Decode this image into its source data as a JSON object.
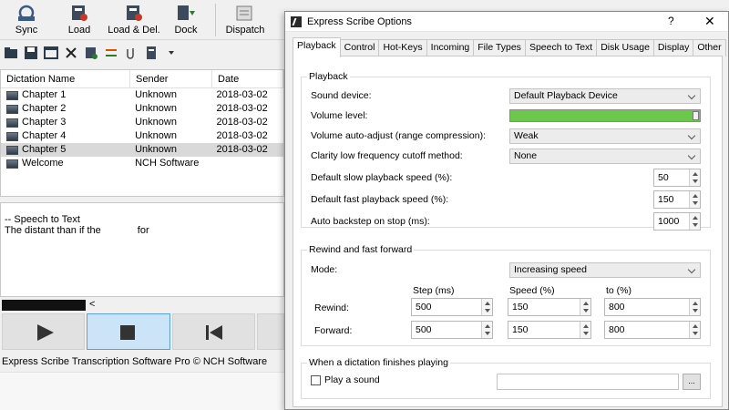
{
  "main": {
    "toolbar": [
      {
        "label": "Sync",
        "icon": "sync-icon"
      },
      {
        "label": "Load",
        "icon": "load-icon"
      },
      {
        "label": "Load & Del.",
        "icon": "load-delete-icon"
      },
      {
        "label": "Dock",
        "icon": "dock-icon"
      },
      {
        "label": "Dispatch",
        "icon": "dispatch-icon"
      }
    ],
    "list": {
      "headers": [
        "Dictation Name",
        "Sender",
        "Date"
      ],
      "rows": [
        {
          "name": "Chapter 1",
          "sender": "Unknown",
          "date": "2018-03-02"
        },
        {
          "name": "Chapter 2",
          "sender": "Unknown",
          "date": "2018-03-02"
        },
        {
          "name": "Chapter 3",
          "sender": "Unknown",
          "date": "2018-03-02"
        },
        {
          "name": "Chapter 4",
          "sender": "Unknown",
          "date": "2018-03-02"
        },
        {
          "name": "Chapter 5",
          "sender": "Unknown",
          "date": "2018-03-02"
        },
        {
          "name": "Welcome",
          "sender": "NCH Software",
          "date": ""
        }
      ],
      "selected_index": 4
    },
    "text_pane": {
      "line1": "-- Speech to Text",
      "line2": "The distant than if the",
      "line2_tail": "for"
    },
    "wave_arrow": "<",
    "status": "Express Scribe Transcription Software Pro © NCH Software"
  },
  "dialog": {
    "title": "Express Scribe Options",
    "help": "?",
    "close": "✕",
    "tabs": [
      "Playback",
      "Control",
      "Hot-Keys",
      "Incoming",
      "File Types",
      "Speech to Text",
      "Disk Usage",
      "Display",
      "Other"
    ],
    "active_tab": "Playback",
    "playback": {
      "group_title": "Playback",
      "sound_device_label": "Sound device:",
      "sound_device_value": "Default Playback Device",
      "volume_label": "Volume level:",
      "volume_level": 1.0,
      "volume_adjust_label": "Volume auto-adjust (range compression):",
      "volume_adjust_value": "Weak",
      "clarity_label": "Clarity low frequency cutoff method:",
      "clarity_value": "None",
      "slow_speed_label": "Default slow playback speed (%):",
      "slow_speed_value": "50",
      "fast_speed_label": "Default fast playback speed (%):",
      "fast_speed_value": "150",
      "backstep_label": "Auto backstep on stop (ms):",
      "backstep_value": "1000"
    },
    "rewind": {
      "group_title": "Rewind and fast forward",
      "mode_label": "Mode:",
      "mode_value": "Increasing speed",
      "col_step": "Step (ms)",
      "col_speed": "Speed (%)",
      "col_to": "to (%)",
      "rewind_label": "Rewind:",
      "rewind_step": "500",
      "rewind_speed": "150",
      "rewind_to": "800",
      "forward_label": "Forward:",
      "forward_step": "500",
      "forward_speed": "150",
      "forward_to": "800"
    },
    "finish": {
      "group_title": "When a dictation finishes playing",
      "play_sound_label": "Play a sound",
      "browse_label": "..."
    }
  }
}
